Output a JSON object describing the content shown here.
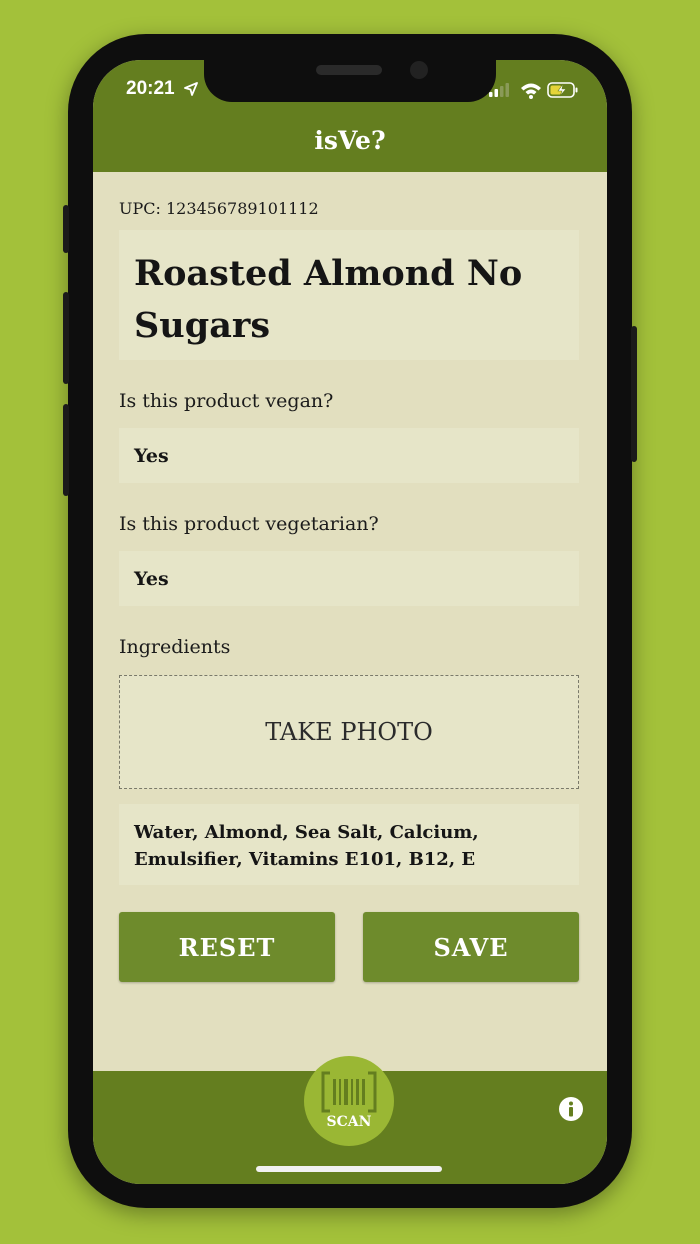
{
  "status_bar": {
    "time": "20:21",
    "icons": [
      "location-arrow-icon",
      "cellular-signal-icon",
      "wifi-icon",
      "battery-charging-icon"
    ]
  },
  "header": {
    "title": "isVe?"
  },
  "product": {
    "upc_text": "UPC: 123456789101112",
    "name": "Roasted Almond No Sugars"
  },
  "vegan": {
    "question": "Is this product vegan?",
    "answer": "Yes"
  },
  "vegetarian": {
    "question": "Is this product vegetarian?",
    "answer": "Yes"
  },
  "ingredients": {
    "label": "Ingredients",
    "photo_button": "TAKE PHOTO",
    "text": "Water, Almond, Sea Salt, Calcium, Emulsifier, Vitamins E101, B12, E"
  },
  "actions": {
    "reset_label": "RESET",
    "save_label": "SAVE"
  },
  "tab_bar": {
    "scan_label": "SCAN",
    "info_icon": "info-icon"
  },
  "colors": {
    "background": "#a3c13a",
    "bar": "#647e1f",
    "content_bg": "#e2dfbf",
    "field_bg": "#e6e5c8",
    "button": "#6e8b2c",
    "scan_circle": "#9ab734"
  }
}
